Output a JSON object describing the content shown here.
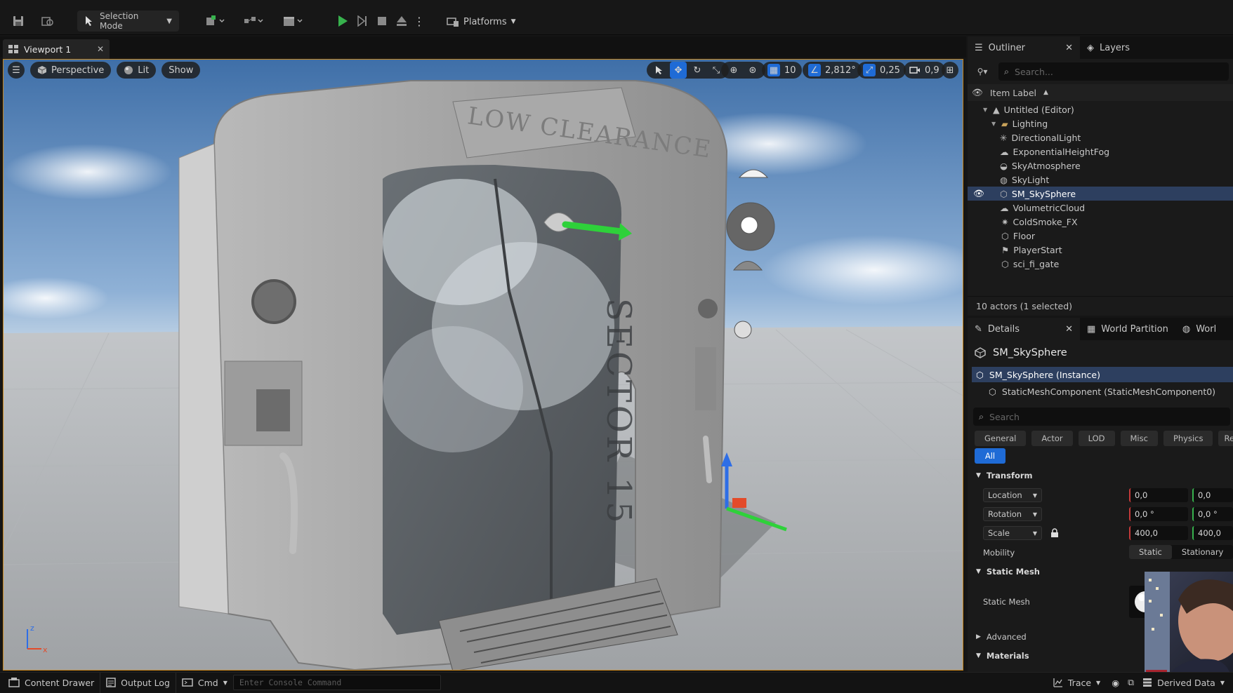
{
  "toolbar": {
    "selection_mode": "Selection Mode",
    "platforms": "Platforms"
  },
  "viewport": {
    "tab_label": "Viewport 1",
    "perspective": "Perspective",
    "lit": "Lit",
    "show": "Show",
    "grid_snap": "10",
    "rotation_snap": "2,812°",
    "scale_snap": "0,25",
    "camera_speed": "0,9",
    "scene_text": {
      "top_sign": "LOW CLEARANCE",
      "door_sign": "SECTOR 15"
    },
    "axis_labels": {
      "z": "z",
      "x": "x"
    }
  },
  "outliner": {
    "tab_label": "Outliner",
    "layers_tab": "Layers",
    "search_placeholder": "Search...",
    "column_header": "Item Label",
    "items": [
      {
        "label": "Untitled (Editor)",
        "indent": 1,
        "icon": "level-icon"
      },
      {
        "label": "Lighting",
        "indent": 2,
        "icon": "folder-icon"
      },
      {
        "label": "DirectionalLight",
        "indent": 3,
        "icon": "directional-light-icon"
      },
      {
        "label": "ExponentialHeightFog",
        "indent": 3,
        "icon": "fog-icon"
      },
      {
        "label": "SkyAtmosphere",
        "indent": 3,
        "icon": "sky-atmosphere-icon"
      },
      {
        "label": "SkyLight",
        "indent": 3,
        "icon": "sky-light-icon"
      },
      {
        "label": "SM_SkySphere",
        "indent": 3,
        "icon": "static-mesh-icon",
        "selected": true
      },
      {
        "label": "VolumetricCloud",
        "indent": 3,
        "icon": "cloud-icon"
      },
      {
        "label": "ColdSmoke_FX",
        "indent": 2,
        "icon": "particle-icon"
      },
      {
        "label": "Floor",
        "indent": 2,
        "icon": "static-mesh-icon"
      },
      {
        "label": "PlayerStart",
        "indent": 2,
        "icon": "player-start-icon"
      },
      {
        "label": "sci_fi_gate",
        "indent": 2,
        "icon": "static-mesh-icon"
      }
    ],
    "status": "10 actors (1 selected)"
  },
  "details": {
    "tab_label": "Details",
    "world_partition_tab": "World Partition",
    "world_tab": "Worl",
    "object_name": "SM_SkySphere",
    "instance_row": "SM_SkySphere (Instance)",
    "component_row": "StaticMeshComponent (StaticMeshComponent0)",
    "search_placeholder": "Search",
    "categories": [
      "General",
      "Actor",
      "LOD",
      "Misc",
      "Physics",
      "Rend"
    ],
    "all_label": "All",
    "transform_section": "Transform",
    "location_label": "Location",
    "rotation_label": "Rotation",
    "scale_label": "Scale",
    "location": [
      "0,0",
      "0,0"
    ],
    "rotation": [
      "0,0 °",
      "0,0 °"
    ],
    "scale": [
      "400,0",
      "400,0"
    ],
    "mobility_label": "Mobility",
    "mobility_options": [
      "Static",
      "Stationary"
    ],
    "static_mesh_section": "Static Mesh",
    "static_mesh_label": "Static Mesh",
    "advanced_section": "Advanced",
    "materials_section": "Materials"
  },
  "bottombar": {
    "content_drawer": "Content Drawer",
    "output_log": "Output Log",
    "cmd": "Cmd",
    "console_placeholder": "Enter Console Command",
    "trace": "Trace",
    "derived_data": "Derived Data"
  },
  "colors": {
    "accent_blue": "#1f6bd6",
    "selection_bg": "#2d3f5f",
    "viewport_border": "#c7851a",
    "play_green": "#37b24d"
  }
}
